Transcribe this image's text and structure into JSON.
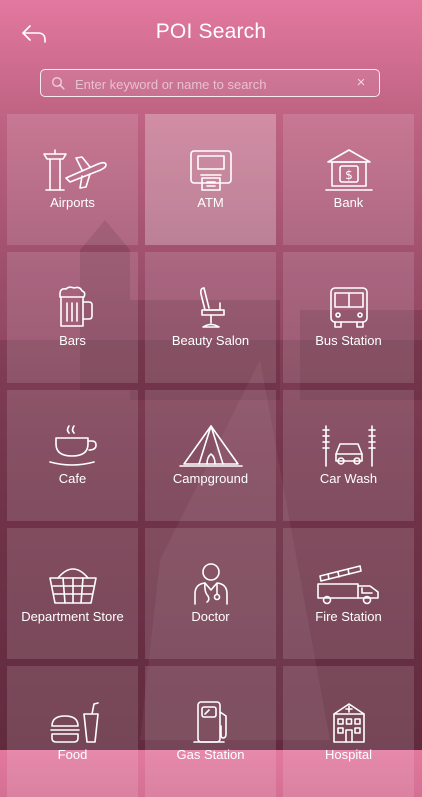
{
  "header": {
    "title": "POI Search"
  },
  "search": {
    "placeholder": "Enter keyword or name to search",
    "value": "",
    "clear_glyph": "×"
  },
  "categories": [
    {
      "label": "Airports",
      "icon": "airport-icon"
    },
    {
      "label": "ATM",
      "icon": "atm-icon"
    },
    {
      "label": "Bank",
      "icon": "bank-icon"
    },
    {
      "label": "Bars",
      "icon": "beer-mug-icon"
    },
    {
      "label": "Beauty Salon",
      "icon": "salon-chair-icon"
    },
    {
      "label": "Bus Station",
      "icon": "bus-icon"
    },
    {
      "label": "Cafe",
      "icon": "coffee-cup-icon"
    },
    {
      "label": "Campground",
      "icon": "tent-icon"
    },
    {
      "label": "Car Wash",
      "icon": "car-wash-icon"
    },
    {
      "label": "Department Store",
      "icon": "shopping-basket-icon"
    },
    {
      "label": "Doctor",
      "icon": "doctor-icon"
    },
    {
      "label": "Fire Station",
      "icon": "fire-truck-icon"
    },
    {
      "label": "Food",
      "icon": "fast-food-icon"
    },
    {
      "label": "Gas Station",
      "icon": "gas-pump-icon"
    },
    {
      "label": "Hospital",
      "icon": "hospital-icon"
    }
  ],
  "colors": {
    "gradient_top": "#e3789f",
    "gradient_bottom": "#6a3045",
    "text": "#ffffff"
  }
}
